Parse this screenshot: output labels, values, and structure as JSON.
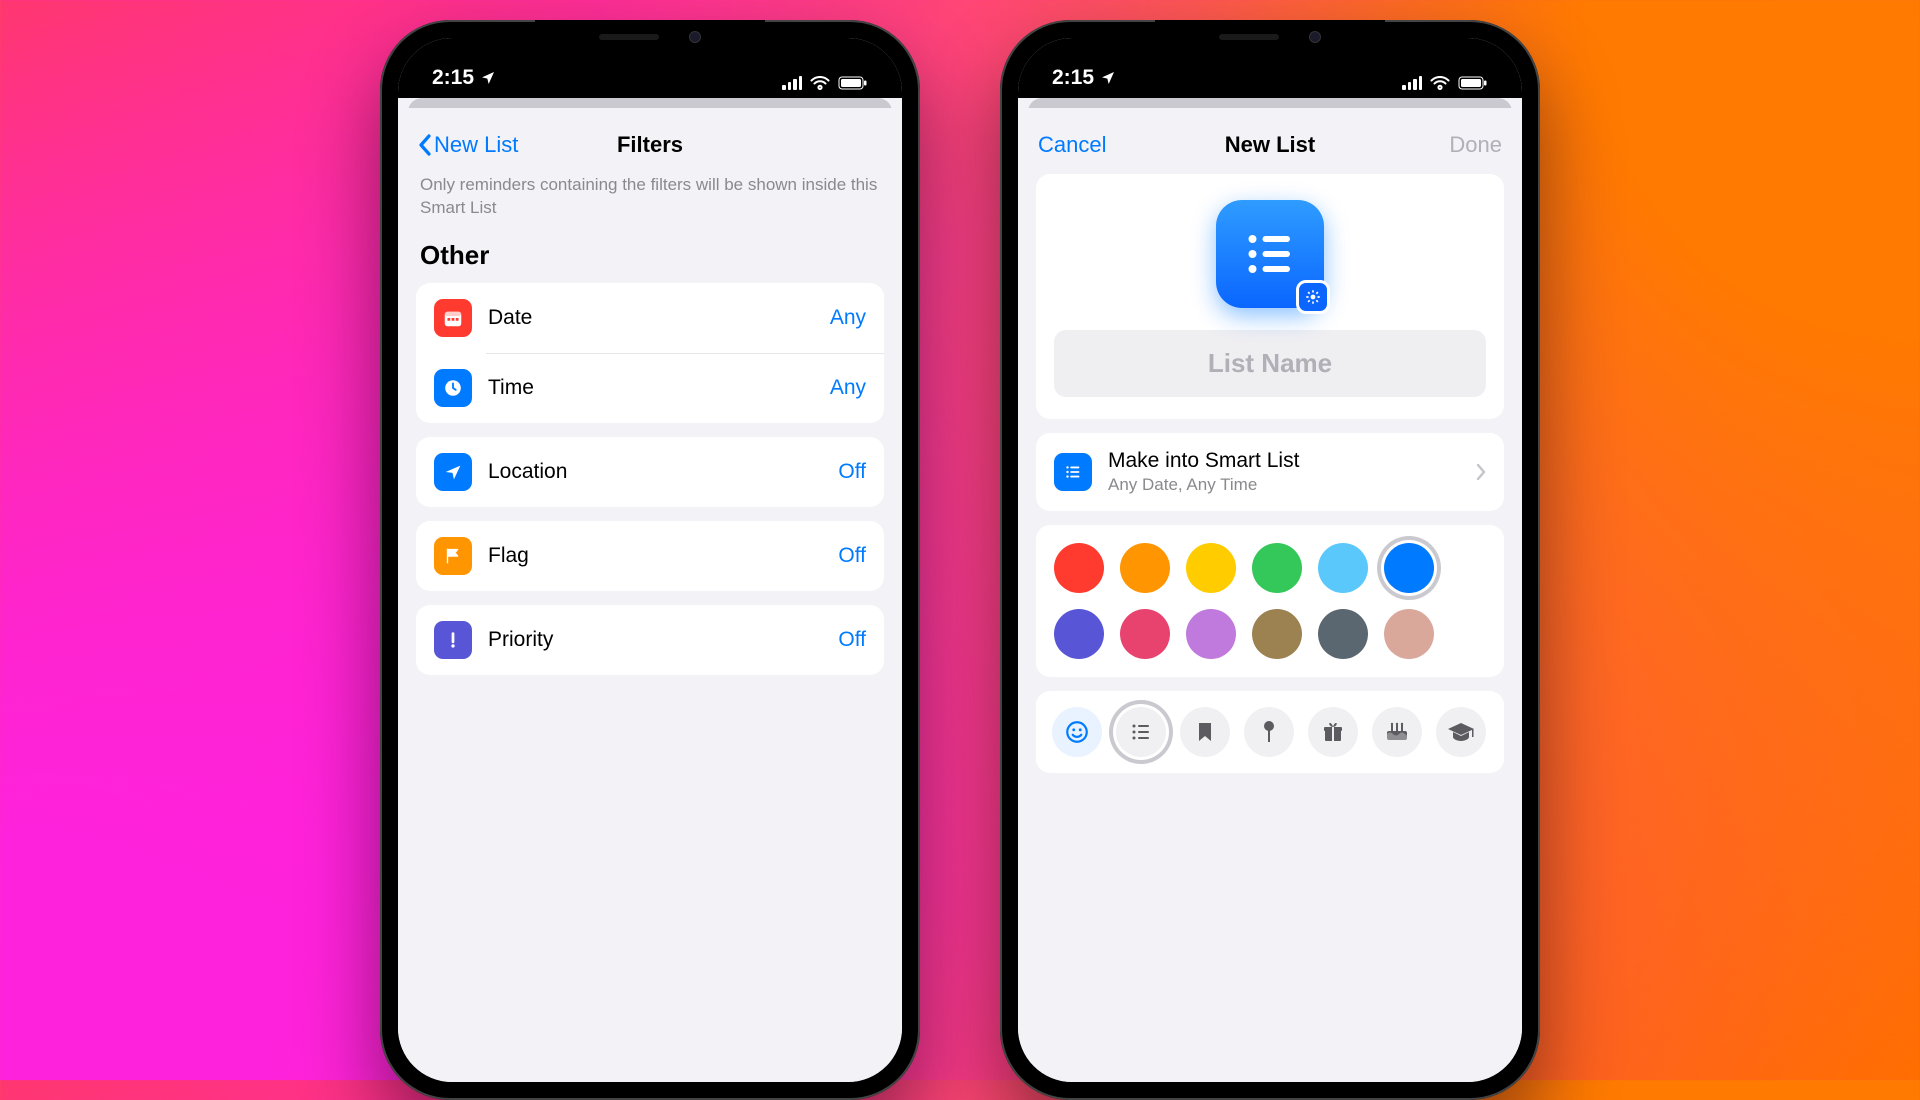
{
  "status": {
    "time": "2:15"
  },
  "left": {
    "back": "New List",
    "title": "Filters",
    "hint": "Only reminders containing the filters will be shown inside this Smart List",
    "section": "Other",
    "rows": {
      "date": {
        "label": "Date",
        "value": "Any"
      },
      "time": {
        "label": "Time",
        "value": "Any"
      },
      "location": {
        "label": "Location",
        "value": "Off"
      },
      "flag": {
        "label": "Flag",
        "value": "Off"
      },
      "priority": {
        "label": "Priority",
        "value": "Off"
      }
    }
  },
  "right": {
    "cancel": "Cancel",
    "title": "New List",
    "done": "Done",
    "placeholder": "List Name",
    "smart": {
      "title": "Make into Smart List",
      "subtitle": "Any Date, Any Time"
    },
    "colors": {
      "options": [
        "#ff3b30",
        "#ff9500",
        "#ffcc00",
        "#34c759",
        "#5ac8fa",
        "#007aff",
        "#5856d6",
        "#e8426f",
        "#c079dc",
        "#9b8250",
        "#5b6770",
        "#d9a89b"
      ],
      "selected": "#007aff"
    },
    "icons": [
      "emoji",
      "list",
      "bookmark",
      "pin",
      "gift",
      "cake",
      "grad"
    ]
  }
}
